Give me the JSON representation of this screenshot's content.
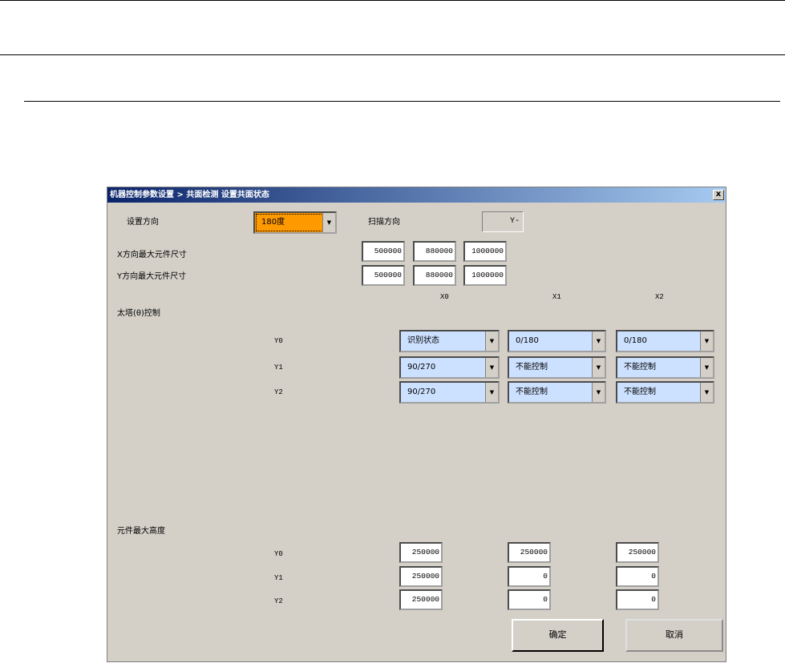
{
  "dialog": {
    "title": "机器控制参数设置 > 共面检测 设置共面状态",
    "close": "x"
  },
  "direction": {
    "label": "设置方向",
    "value": "180度",
    "highlight": "#ff9900"
  },
  "scan": {
    "label": "扫描方向",
    "value": "Y-"
  },
  "xsize": {
    "label": "X方向最大元件尺寸",
    "values": [
      "500000",
      "880000",
      "1000000"
    ]
  },
  "ysize": {
    "label": "Y方向最大元件尺寸",
    "values": [
      "500000",
      "880000",
      "1000000"
    ]
  },
  "columns": [
    "X0",
    "X1",
    "X2"
  ],
  "turret": {
    "label": "太塔(θ)控制",
    "rows": [
      {
        "label": "Y0",
        "values": [
          "识别状态",
          "0/180",
          "0/180"
        ]
      },
      {
        "label": "Y1",
        "values": [
          "90/270",
          "不能控制",
          "不能控制"
        ]
      },
      {
        "label": "Y2",
        "values": [
          "90/270",
          "不能控制",
          "不能控制"
        ]
      }
    ]
  },
  "height": {
    "label": "元件最大高度",
    "rows": [
      {
        "label": "Y0",
        "values": [
          "250000",
          "250000",
          "250000"
        ]
      },
      {
        "label": "Y1",
        "values": [
          "250000",
          "0",
          "0"
        ]
      },
      {
        "label": "Y2",
        "values": [
          "250000",
          "0",
          "0"
        ]
      }
    ]
  },
  "buttons": {
    "ok": "确定",
    "cancel": "取消"
  }
}
